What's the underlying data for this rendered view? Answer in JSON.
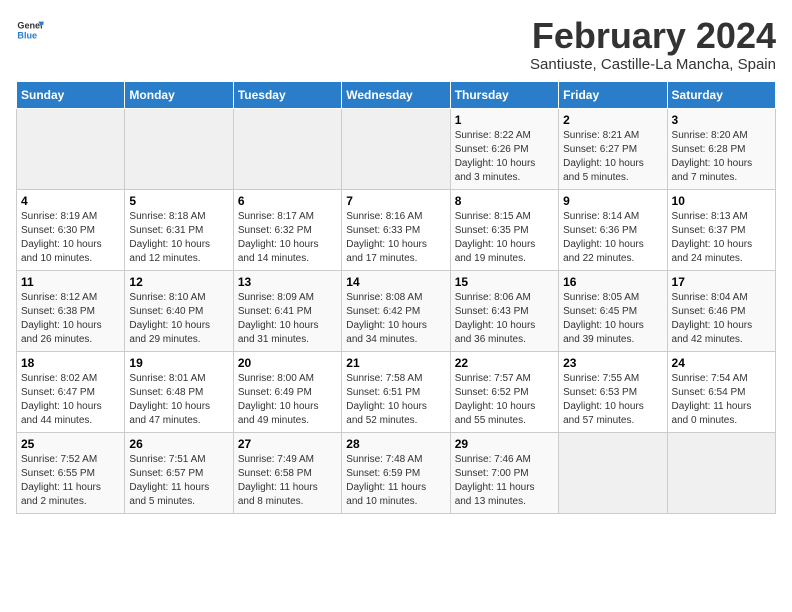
{
  "header": {
    "logo_general": "General",
    "logo_blue": "Blue",
    "title": "February 2024",
    "subtitle": "Santiuste, Castille-La Mancha, Spain"
  },
  "weekdays": [
    "Sunday",
    "Monday",
    "Tuesday",
    "Wednesday",
    "Thursday",
    "Friday",
    "Saturday"
  ],
  "weeks": [
    [
      {
        "day": "",
        "info": ""
      },
      {
        "day": "",
        "info": ""
      },
      {
        "day": "",
        "info": ""
      },
      {
        "day": "",
        "info": ""
      },
      {
        "day": "1",
        "info": "Sunrise: 8:22 AM\nSunset: 6:26 PM\nDaylight: 10 hours\nand 3 minutes."
      },
      {
        "day": "2",
        "info": "Sunrise: 8:21 AM\nSunset: 6:27 PM\nDaylight: 10 hours\nand 5 minutes."
      },
      {
        "day": "3",
        "info": "Sunrise: 8:20 AM\nSunset: 6:28 PM\nDaylight: 10 hours\nand 7 minutes."
      }
    ],
    [
      {
        "day": "4",
        "info": "Sunrise: 8:19 AM\nSunset: 6:30 PM\nDaylight: 10 hours\nand 10 minutes."
      },
      {
        "day": "5",
        "info": "Sunrise: 8:18 AM\nSunset: 6:31 PM\nDaylight: 10 hours\nand 12 minutes."
      },
      {
        "day": "6",
        "info": "Sunrise: 8:17 AM\nSunset: 6:32 PM\nDaylight: 10 hours\nand 14 minutes."
      },
      {
        "day": "7",
        "info": "Sunrise: 8:16 AM\nSunset: 6:33 PM\nDaylight: 10 hours\nand 17 minutes."
      },
      {
        "day": "8",
        "info": "Sunrise: 8:15 AM\nSunset: 6:35 PM\nDaylight: 10 hours\nand 19 minutes."
      },
      {
        "day": "9",
        "info": "Sunrise: 8:14 AM\nSunset: 6:36 PM\nDaylight: 10 hours\nand 22 minutes."
      },
      {
        "day": "10",
        "info": "Sunrise: 8:13 AM\nSunset: 6:37 PM\nDaylight: 10 hours\nand 24 minutes."
      }
    ],
    [
      {
        "day": "11",
        "info": "Sunrise: 8:12 AM\nSunset: 6:38 PM\nDaylight: 10 hours\nand 26 minutes."
      },
      {
        "day": "12",
        "info": "Sunrise: 8:10 AM\nSunset: 6:40 PM\nDaylight: 10 hours\nand 29 minutes."
      },
      {
        "day": "13",
        "info": "Sunrise: 8:09 AM\nSunset: 6:41 PM\nDaylight: 10 hours\nand 31 minutes."
      },
      {
        "day": "14",
        "info": "Sunrise: 8:08 AM\nSunset: 6:42 PM\nDaylight: 10 hours\nand 34 minutes."
      },
      {
        "day": "15",
        "info": "Sunrise: 8:06 AM\nSunset: 6:43 PM\nDaylight: 10 hours\nand 36 minutes."
      },
      {
        "day": "16",
        "info": "Sunrise: 8:05 AM\nSunset: 6:45 PM\nDaylight: 10 hours\nand 39 minutes."
      },
      {
        "day": "17",
        "info": "Sunrise: 8:04 AM\nSunset: 6:46 PM\nDaylight: 10 hours\nand 42 minutes."
      }
    ],
    [
      {
        "day": "18",
        "info": "Sunrise: 8:02 AM\nSunset: 6:47 PM\nDaylight: 10 hours\nand 44 minutes."
      },
      {
        "day": "19",
        "info": "Sunrise: 8:01 AM\nSunset: 6:48 PM\nDaylight: 10 hours\nand 47 minutes."
      },
      {
        "day": "20",
        "info": "Sunrise: 8:00 AM\nSunset: 6:49 PM\nDaylight: 10 hours\nand 49 minutes."
      },
      {
        "day": "21",
        "info": "Sunrise: 7:58 AM\nSunset: 6:51 PM\nDaylight: 10 hours\nand 52 minutes."
      },
      {
        "day": "22",
        "info": "Sunrise: 7:57 AM\nSunset: 6:52 PM\nDaylight: 10 hours\nand 55 minutes."
      },
      {
        "day": "23",
        "info": "Sunrise: 7:55 AM\nSunset: 6:53 PM\nDaylight: 10 hours\nand 57 minutes."
      },
      {
        "day": "24",
        "info": "Sunrise: 7:54 AM\nSunset: 6:54 PM\nDaylight: 11 hours\nand 0 minutes."
      }
    ],
    [
      {
        "day": "25",
        "info": "Sunrise: 7:52 AM\nSunset: 6:55 PM\nDaylight: 11 hours\nand 2 minutes."
      },
      {
        "day": "26",
        "info": "Sunrise: 7:51 AM\nSunset: 6:57 PM\nDaylight: 11 hours\nand 5 minutes."
      },
      {
        "day": "27",
        "info": "Sunrise: 7:49 AM\nSunset: 6:58 PM\nDaylight: 11 hours\nand 8 minutes."
      },
      {
        "day": "28",
        "info": "Sunrise: 7:48 AM\nSunset: 6:59 PM\nDaylight: 11 hours\nand 10 minutes."
      },
      {
        "day": "29",
        "info": "Sunrise: 7:46 AM\nSunset: 7:00 PM\nDaylight: 11 hours\nand 13 minutes."
      },
      {
        "day": "",
        "info": ""
      },
      {
        "day": "",
        "info": ""
      }
    ]
  ]
}
